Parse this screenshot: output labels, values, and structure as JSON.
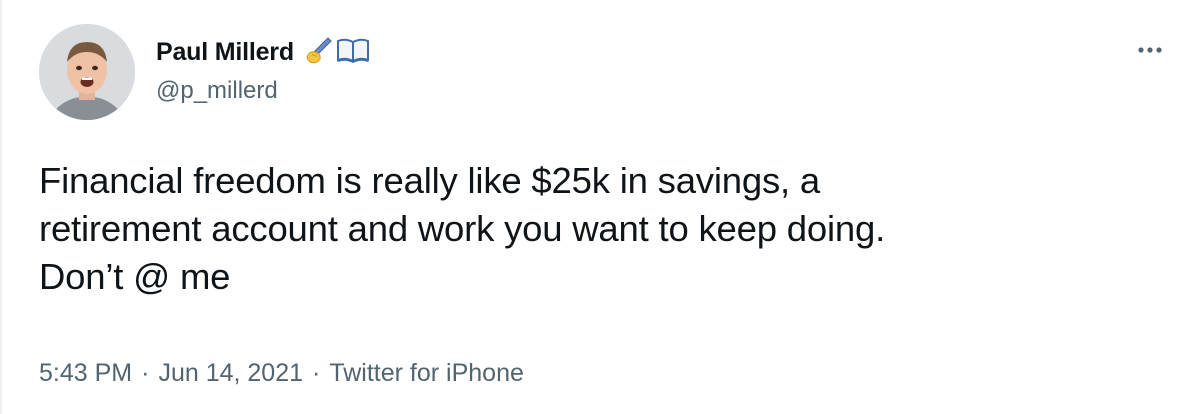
{
  "author": {
    "display_name": "Paul Millerd",
    "name_emoji": [
      "writing-hand-icon",
      "open-book-icon"
    ],
    "handle": "@p_millerd"
  },
  "tweet": {
    "text_lines": [
      "Financial freedom is really like $25k in savings, a",
      "retirement account and work you want to keep doing.",
      "Don’t @ me"
    ],
    "time": "5:43 PM",
    "separator": "·",
    "date": "Jun 14, 2021",
    "source": "Twitter for iPhone"
  },
  "actions": {
    "more_icon": "more-horizontal-icon"
  },
  "colors": {
    "text": "#0f1419",
    "secondary": "#536471",
    "background": "#ffffff"
  }
}
